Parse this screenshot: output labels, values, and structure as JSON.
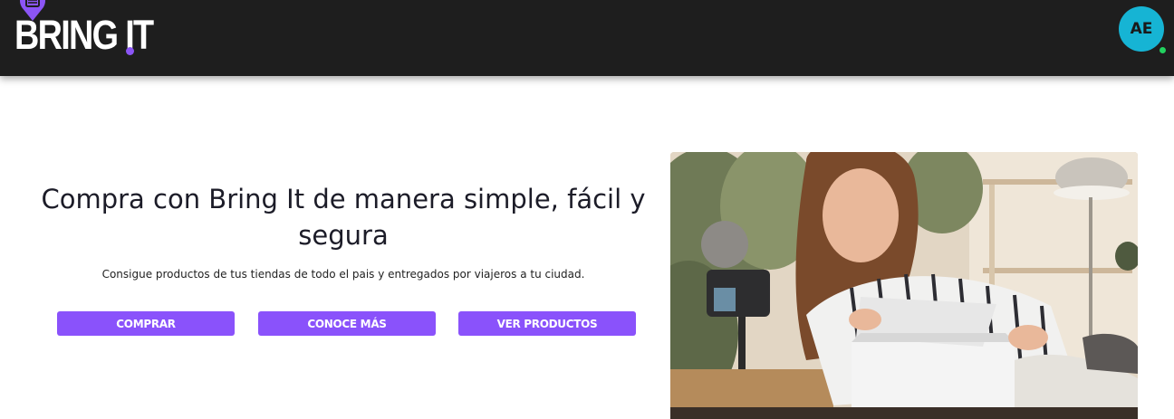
{
  "header": {
    "logo": {
      "text": "BRING IT",
      "icon": "map-pin-bag-icon",
      "accent_color": "#8b55f5"
    },
    "avatar": {
      "initials": "AE",
      "color": "#16b4d4",
      "status_color": "#22d15f"
    },
    "background": "#1e1e1e"
  },
  "hero": {
    "title": "Compra con Bring It de manera simple, fácil y segura",
    "subtitle": "Consigue productos de tus tiendas de todo el pais y entregados por viajeros a tu ciudad.",
    "buttons": [
      {
        "label": "COMPRAR"
      },
      {
        "label": "CONOCE MÁS"
      },
      {
        "label": "VER PRODUCTOS"
      }
    ],
    "button_color": "#8a52fb",
    "image": {
      "subject": "woman-unboxing-package-photo"
    }
  }
}
